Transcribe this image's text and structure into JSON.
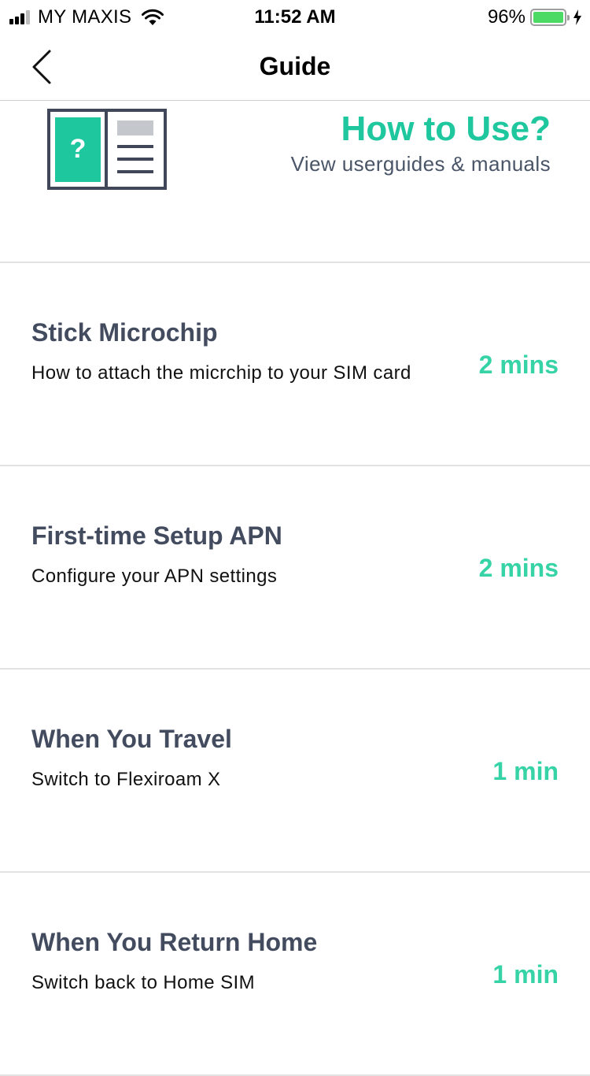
{
  "status_bar": {
    "carrier": "MY MAXIS",
    "time": "11:52 AM",
    "battery_percent": "96%",
    "signal_bars_active": 3,
    "signal_bars_total": 4,
    "battery_level": 0.96,
    "battery_color": "#4cd964"
  },
  "nav": {
    "title": "Guide",
    "back_icon": "chevron-left-icon"
  },
  "hero": {
    "icon": "guide-book-icon",
    "title": "How to Use?",
    "subtitle": "View userguides & manuals",
    "accent_color": "#1fc79e"
  },
  "guides": [
    {
      "title": "Stick Microchip",
      "description": "How to attach the micrchip to your SIM card",
      "duration": "2 mins"
    },
    {
      "title": "First-time Setup APN",
      "description": "Configure your APN settings",
      "duration": "2 mins"
    },
    {
      "title": "When You Travel",
      "description": "Switch to Flexiroam X",
      "duration": "1 min"
    },
    {
      "title": "When You Return Home",
      "description": "Switch back to Home SIM",
      "duration": "1 min"
    }
  ]
}
